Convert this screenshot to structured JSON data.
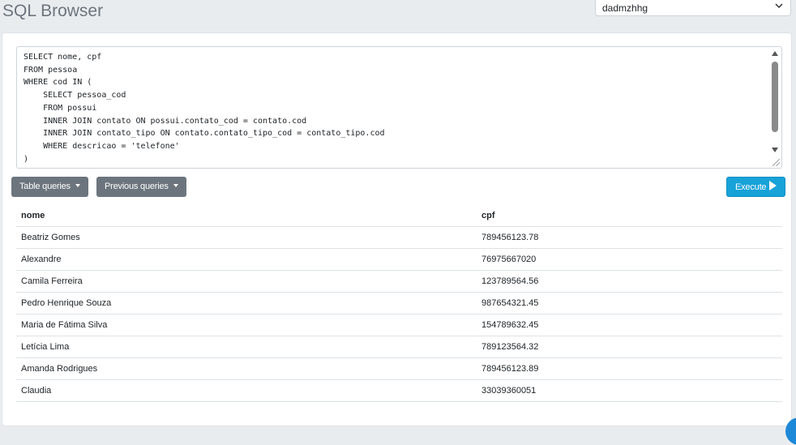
{
  "header": {
    "title": "SQL Browser",
    "database_selected": "dadmzhhg"
  },
  "editor": {
    "query": "SELECT nome, cpf\nFROM pessoa\nWHERE cod IN (\n    SELECT pessoa_cod\n    FROM possui\n    INNER JOIN contato ON possui.contato_cod = contato.cod\n    INNER JOIN contato_tipo ON contato.contato_tipo_cod = contato_tipo.cod\n    WHERE descricao = 'telefone'\n)"
  },
  "toolbar": {
    "table_queries_label": "Table queries",
    "previous_queries_label": "Previous queries",
    "execute_label": "Execute"
  },
  "colors": {
    "secondary_button": "#6c757d",
    "execute_button": "#17a2d8"
  },
  "results": {
    "columns": [
      "nome",
      "cpf"
    ],
    "rows": [
      [
        "Beatriz Gomes",
        "789456123.78"
      ],
      [
        "Alexandre",
        "76975667020"
      ],
      [
        "Camila Ferreira",
        "123789564.56"
      ],
      [
        "Pedro Henrique Souza",
        "987654321.45"
      ],
      [
        "Maria de Fátima Silva",
        "154789632.45"
      ],
      [
        "Letícia Lima",
        "789123564.32"
      ],
      [
        "Amanda Rodrigues",
        "789456123.89"
      ],
      [
        "Claudia",
        "33039360051"
      ]
    ]
  }
}
